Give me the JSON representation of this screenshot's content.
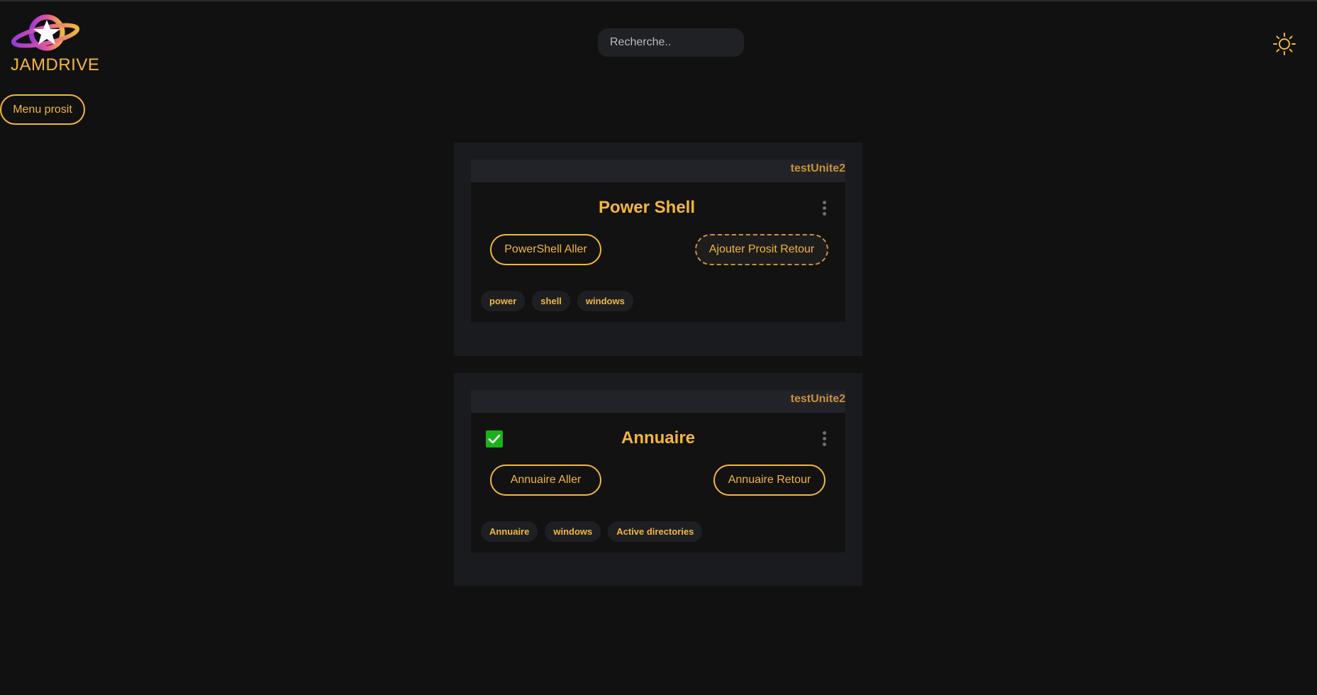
{
  "app": {
    "name": "JAMDRIVE"
  },
  "header": {
    "search_placeholder": "Recherche..",
    "theme_toggle_icon": "sun-icon"
  },
  "sidebar": {
    "menu_button_label": "Menu prosit"
  },
  "colors": {
    "accent": "#f3b63f",
    "background": "#111111",
    "card_outer": "#1a1b1e",
    "card_head": "#222328",
    "card_body": "#121212",
    "check_green": "#19b319"
  },
  "cards": [
    {
      "unit": "testUnite2",
      "title": "Power Shell",
      "completed": false,
      "buttons": {
        "aller": "PowerShell Aller",
        "retour": "Ajouter Prosit Retour"
      },
      "tags": [
        "power",
        "shell",
        "windows"
      ]
    },
    {
      "unit": "testUnite2",
      "title": "Annuaire",
      "completed": true,
      "buttons": {
        "aller": "Annuaire Aller",
        "retour": "Annuaire Retour"
      },
      "tags": [
        "Annuaire",
        "windows",
        "Active directories"
      ]
    }
  ]
}
